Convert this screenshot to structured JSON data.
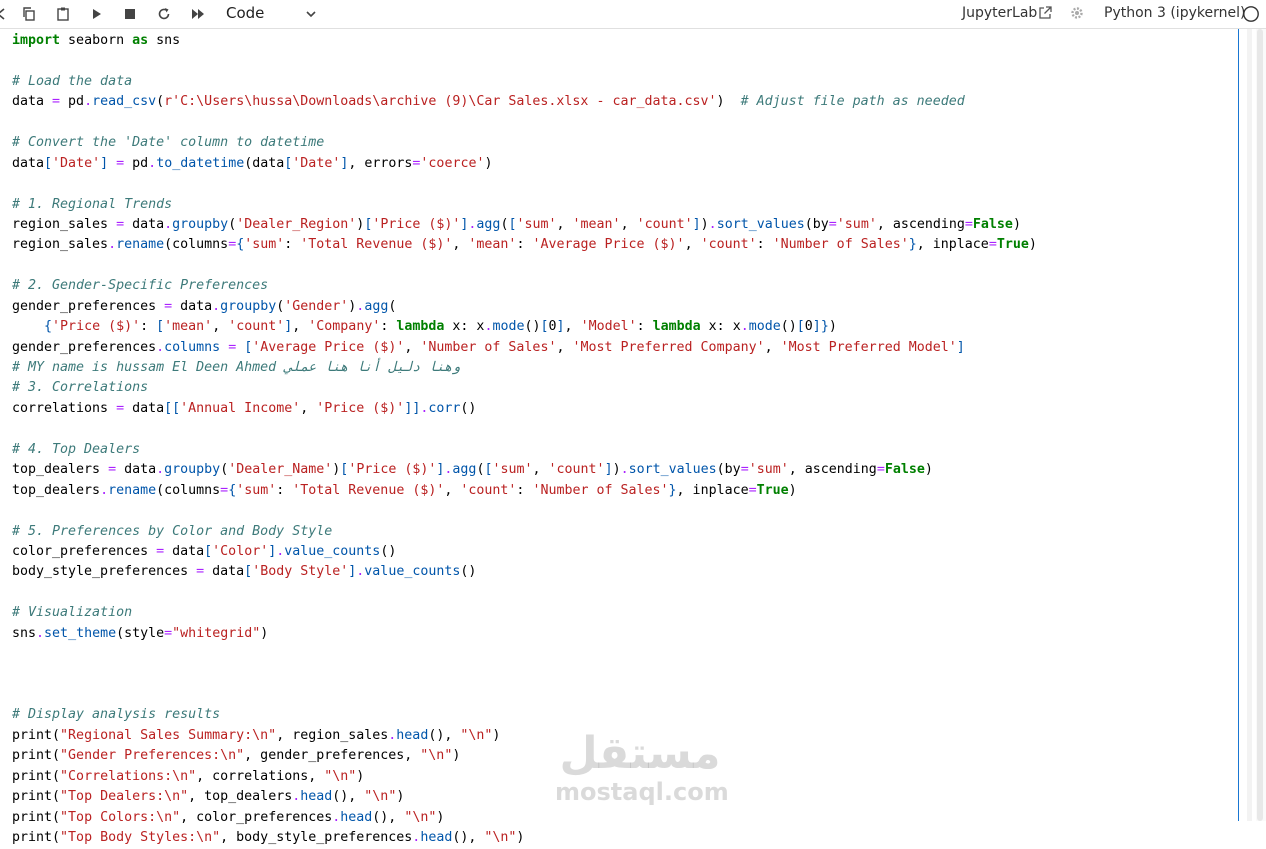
{
  "toolbar": {
    "cell_type": "Code",
    "app_link": "JupyterLab",
    "kernel": "Python 3 (ipykernel)",
    "icons": [
      "cut-icon",
      "copy-icon",
      "paste-icon",
      "run-icon",
      "stop-icon",
      "restart-icon",
      "fast-forward-icon",
      "chevron-down-icon",
      "external-link-icon",
      "gear-icon",
      "kernel-status-icon"
    ]
  },
  "watermark": {
    "arabic": "مستقل",
    "latin": "mostaql.com"
  },
  "code_lines": [
    "[[\"kw\",\"import\"],[\"\",\" seaborn \"],[\"kw\",\"as\"],[\"\",\" sns\"]]",
    "[]",
    "[[\"cm\",\"# Load the data\"]]",
    "[[\"\",\"data \"],[\"op\",\"=\"],[\"\",\" pd\"],[\"op\",\".\"],[\"fn\",\"read_csv\"],[\"\",\"(\"],[\"st\",\"r'C:\\\\Users\\\\hussa\\\\Downloads\\\\archive (9)\\\\Car Sales.xlsx - car_data.csv'\"],[\"\",\")  \"],[\"cm\",\"# Adjust file path as needed\"]]",
    "[]",
    "[[\"cm\",\"# Convert the 'Date' column to datetime\"]]",
    "[[\"\",\"data\"],[\"pn\",\"[\"],[\"st\",\"'Date'\"],[\"pn\",\"]\"],[\"\",\" \"],[\"op\",\"=\"],[\"\",\" pd\"],[\"op\",\".\"],[\"fn\",\"to_datetime\"],[\"\",\"(data\"],[\"pn\",\"[\"],[\"st\",\"'Date'\"],[\"pn\",\"]\"],[\"\",\", errors\"],[\"op\",\"=\"],[\"st\",\"'coerce'\"],[\"\",\")\"]]",
    "[]",
    "[[\"cm\",\"# 1. Regional Trends\"]]",
    "[[\"\",\"region_sales \"],[\"op\",\"=\"],[\"\",\" data\"],[\"op\",\".\"],[\"fn\",\"groupby\"],[\"\",\"(\"],[\"st\",\"'Dealer_Region'\"],[\"\",\")\"],[\"pn\",\"[\"],[\"st\",\"'Price ($)'\"],[\"pn\",\"]\"],[\"op\",\".\"],[\"fn\",\"agg\"],[\"\",\"(\"],[\"pn\",\"[\"],[\"st\",\"'sum'\"],[\"\",\", \"],[\"st\",\"'mean'\"],[\"\",\", \"],[\"st\",\"'count'\"],[\"pn\",\"]\"],[\"\",\")\"],[\"op\",\".\"],[\"fn\",\"sort_values\"],[\"\",\"(by\"],[\"op\",\"=\"],[\"st\",\"'sum'\"],[\"\",\", ascending\"],[\"op\",\"=\"],[\"kw\",\"False\"],[\"\",\")\"]]",
    "[[\"\",\"region_sales\"],[\"op\",\".\"],[\"fn\",\"rename\"],[\"\",\"(columns\"],[\"op\",\"=\"],[\"pn\",\"{\"],[\"st\",\"'sum'\"],[\"\",\": \"],[\"st\",\"'Total Revenue ($)'\"],[\"\",\", \"],[\"st\",\"'mean'\"],[\"\",\": \"],[\"st\",\"'Average Price ($)'\"],[\"\",\", \"],[\"st\",\"'count'\"],[\"\",\": \"],[\"st\",\"'Number of Sales'\"],[\"pn\",\"}\"],[\"\",\", inplace\"],[\"op\",\"=\"],[\"kw\",\"True\"],[\"\",\")\"]]",
    "[]",
    "[[\"cm\",\"# 2. Gender-Specific Preferences\"]]",
    "[[\"\",\"gender_preferences \"],[\"op\",\"=\"],[\"\",\" data\"],[\"op\",\".\"],[\"fn\",\"groupby\"],[\"\",\"(\"],[\"st\",\"'Gender'\"],[\"\",\")\"],[\"op\",\".\"],[\"fn\",\"agg\"],[\"\",\"(\"]]",
    "[[\"\",\"    \"],[\"pn\",\"{\"],[\"st\",\"'Price ($)'\"],[\"\",\": \"],[\"pn\",\"[\"],[\"st\",\"'mean'\"],[\"\",\", \"],[\"st\",\"'count'\"],[\"pn\",\"]\"],[\"\",\", \"],[\"st\",\"'Company'\"],[\"\",\": \"],[\"kw\",\"lambda\"],[\"\",\" x: x\"],[\"op\",\".\"],[\"fn\",\"mode\"],[\"\",\"()\"],[\"pn\",\"[\"],[\"\",\"0\"],[\"pn\",\"]\"],[\"\",\", \"],[\"st\",\"'Model'\"],[\"\",\": \"],[\"kw\",\"lambda\"],[\"\",\" x: x\"],[\"op\",\".\"],[\"fn\",\"mode\"],[\"\",\"()\"],[\"pn\",\"[\"],[\"\",\"0\"],[\"pn\",\"]\"],[\"pn\",\"}\"],[\"\",\")\"]]",
    "[[\"\",\"gender_preferences\"],[\"op\",\".\"],[\"fn\",\"columns\"],[\"\",\" \"],[\"op\",\"=\"],[\"\",\" \"],[\"pn\",\"[\"],[\"st\",\"'Average Price ($)'\"],[\"\",\", \"],[\"st\",\"'Number of Sales'\"],[\"\",\", \"],[\"st\",\"'Most Preferred Company'\"],[\"\",\", \"],[\"st\",\"'Most Preferred Model'\"],[\"pn\",\"]\"]]",
    "[[\"cm\",\"# MY name is hussam El Deen Ahmed وهنا دليل أنا هنا عملي\"]]",
    "[[\"cm\",\"# 3. Correlations\"]]",
    "[[\"\",\"correlations \"],[\"op\",\"=\"],[\"\",\" data\"],[\"pn\",\"[[\"],[\"st\",\"'Annual Income'\"],[\"\",\", \"],[\"st\",\"'Price ($)'\"],[\"pn\",\"]]\"],[\"op\",\".\"],[\"fn\",\"corr\"],[\"\",\"()\"]]",
    "[]",
    "[[\"cm\",\"# 4. Top Dealers\"]]",
    "[[\"\",\"top_dealers \"],[\"op\",\"=\"],[\"\",\" data\"],[\"op\",\".\"],[\"fn\",\"groupby\"],[\"\",\"(\"],[\"st\",\"'Dealer_Name'\"],[\"\",\")\"],[\"pn\",\"[\"],[\"st\",\"'Price ($)'\"],[\"pn\",\"]\"],[\"op\",\".\"],[\"fn\",\"agg\"],[\"\",\"(\"],[\"pn\",\"[\"],[\"st\",\"'sum'\"],[\"\",\", \"],[\"st\",\"'count'\"],[\"pn\",\"]\"],[\"\",\")\"],[\"op\",\".\"],[\"fn\",\"sort_values\"],[\"\",\"(by\"],[\"op\",\"=\"],[\"st\",\"'sum'\"],[\"\",\", ascending\"],[\"op\",\"=\"],[\"kw\",\"False\"],[\"\",\")\"]]",
    "[[\"\",\"top_dealers\"],[\"op\",\".\"],[\"fn\",\"rename\"],[\"\",\"(columns\"],[\"op\",\"=\"],[\"pn\",\"{\"],[\"st\",\"'sum'\"],[\"\",\": \"],[\"st\",\"'Total Revenue ($)'\"],[\"\",\", \"],[\"st\",\"'count'\"],[\"\",\": \"],[\"st\",\"'Number of Sales'\"],[\"pn\",\"}\"],[\"\",\", inplace\"],[\"op\",\"=\"],[\"kw\",\"True\"],[\"\",\")\"]]",
    "[]",
    "[[\"cm\",\"# 5. Preferences by Color and Body Style\"]]",
    "[[\"\",\"color_preferences \"],[\"op\",\"=\"],[\"\",\" data\"],[\"pn\",\"[\"],[\"st\",\"'Color'\"],[\"pn\",\"]\"],[\"op\",\".\"],[\"fn\",\"value_counts\"],[\"\",\"()\"]]",
    "[[\"\",\"body_style_preferences \"],[\"op\",\"=\"],[\"\",\" data\"],[\"pn\",\"[\"],[\"st\",\"'Body Style'\"],[\"pn\",\"]\"],[\"op\",\".\"],[\"fn\",\"value_counts\"],[\"\",\"()\"]]",
    "[]",
    "[[\"cm\",\"# Visualization\"]]",
    "[[\"\",\"sns\"],[\"op\",\".\"],[\"fn\",\"set_theme\"],[\"\",\"(style\"],[\"op\",\"=\"],[\"st\",\"\\\"whitegrid\\\"\"],[\"\",\")\"]]",
    "[]",
    "[]",
    "[]",
    "[[\"cm\",\"# Display analysis results\"]]",
    "[[\"\",\"print(\"],[\"st\",\"\\\"Regional Sales Summary:\\\\n\\\"\"],[\"\",\", region_sales\"],[\"op\",\".\"],[\"fn\",\"head\"],[\"\",\"(), \"],[\"st\",\"\\\"\\\\n\\\"\"],[\"\",\")\"]]",
    "[[\"\",\"print(\"],[\"st\",\"\\\"Gender Preferences:\\\\n\\\"\"],[\"\",\", gender_preferences, \"],[\"st\",\"\\\"\\\\n\\\"\"],[\"\",\")\"]]",
    "[[\"\",\"print(\"],[\"st\",\"\\\"Correlations:\\\\n\\\"\"],[\"\",\", correlations, \"],[\"st\",\"\\\"\\\\n\\\"\"],[\"\",\")\"]]",
    "[[\"\",\"print(\"],[\"st\",\"\\\"Top Dealers:\\\\n\\\"\"],[\"\",\", top_dealers\"],[\"op\",\".\"],[\"fn\",\"head\"],[\"\",\"(), \"],[\"st\",\"\\\"\\\\n\\\"\"],[\"\",\")\"]]",
    "[[\"\",\"print(\"],[\"st\",\"\\\"Top Colors:\\\\n\\\"\"],[\"\",\", color_preferences\"],[\"op\",\".\"],[\"fn\",\"head\"],[\"\",\"(), \"],[\"st\",\"\\\"\\\\n\\\"\"],[\"\",\")\"]]",
    "[[\"\",\"print(\"],[\"st\",\"\\\"Top Body Styles:\\\\n\\\"\"],[\"\",\", body_style_preferences\"],[\"op\",\".\"],[\"fn\",\"head\"],[\"\",\"(), \"],[\"st\",\"\\\"\\\\n\\\"\"],[\"\",\")\"]]"
  ]
}
